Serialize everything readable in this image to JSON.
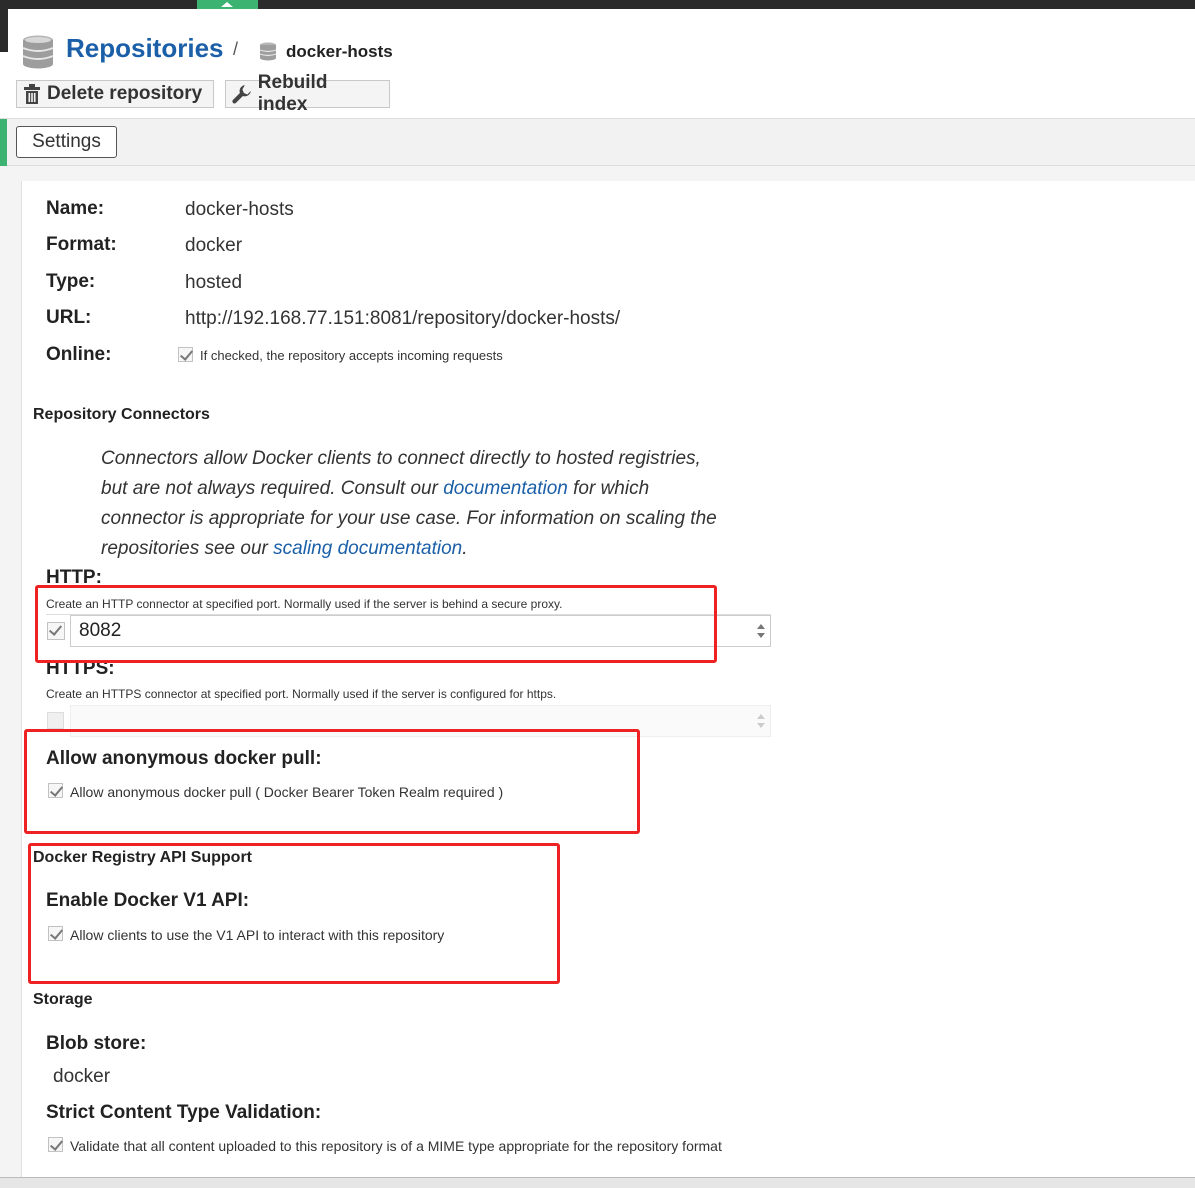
{
  "header": {
    "title": "Repositories",
    "separator": "/",
    "crumb": "docker-hosts"
  },
  "toolbar": {
    "delete_label": "Delete repository",
    "rebuild_label": "Rebuild index"
  },
  "tabs": {
    "settings": "Settings"
  },
  "details": {
    "name_label": "Name:",
    "name_value": "docker-hosts",
    "format_label": "Format:",
    "format_value": "docker",
    "type_label": "Type:",
    "type_value": "hosted",
    "url_label": "URL:",
    "url_value": "http://192.168.77.151:8081/repository/docker-hosts/",
    "online_label": "Online:",
    "online_help": "If checked, the repository accepts incoming requests",
    "online_checked": true
  },
  "connectors": {
    "section_title": "Repository Connectors",
    "desc_1": "Connectors allow Docker clients to connect directly to hosted registries, but are not always required. Consult our ",
    "desc_link_1": "documentation",
    "desc_2": " for which connector is appropriate for your use case. For information on scaling the repositories see our ",
    "desc_link_2": "scaling documentation",
    "desc_3": ".",
    "http_label": "HTTP:",
    "http_help": "Create an HTTP connector at specified port. Normally used if the server is behind a secure proxy.",
    "http_checked": true,
    "http_port": "8082",
    "https_label": "HTTPS:",
    "https_help": "Create an HTTPS connector at specified port. Normally used if the server is configured for https.",
    "https_checked": false,
    "https_port": ""
  },
  "anonymous": {
    "label": "Allow anonymous docker pull:",
    "help": "Allow anonymous docker pull ( Docker Bearer Token Realm required )",
    "checked": true
  },
  "api": {
    "section_title": "Docker Registry API Support",
    "label": "Enable Docker V1 API:",
    "help": "Allow clients to use the V1 API to interact with this repository",
    "checked": true
  },
  "storage": {
    "section_title": "Storage",
    "blob_label": "Blob store:",
    "blob_value": "docker",
    "strict_label": "Strict Content Type Validation:",
    "strict_help": "Validate that all content uploaded to this repository is of a MIME type appropriate for the repository format",
    "strict_checked": true
  },
  "colors": {
    "accent": "#3cb371",
    "link": "#1a5fa8",
    "highlight": "#ee2222"
  },
  "icons": [
    "database-icon",
    "trash-icon",
    "wrench-icon",
    "check-icon",
    "spinner-icon"
  ]
}
